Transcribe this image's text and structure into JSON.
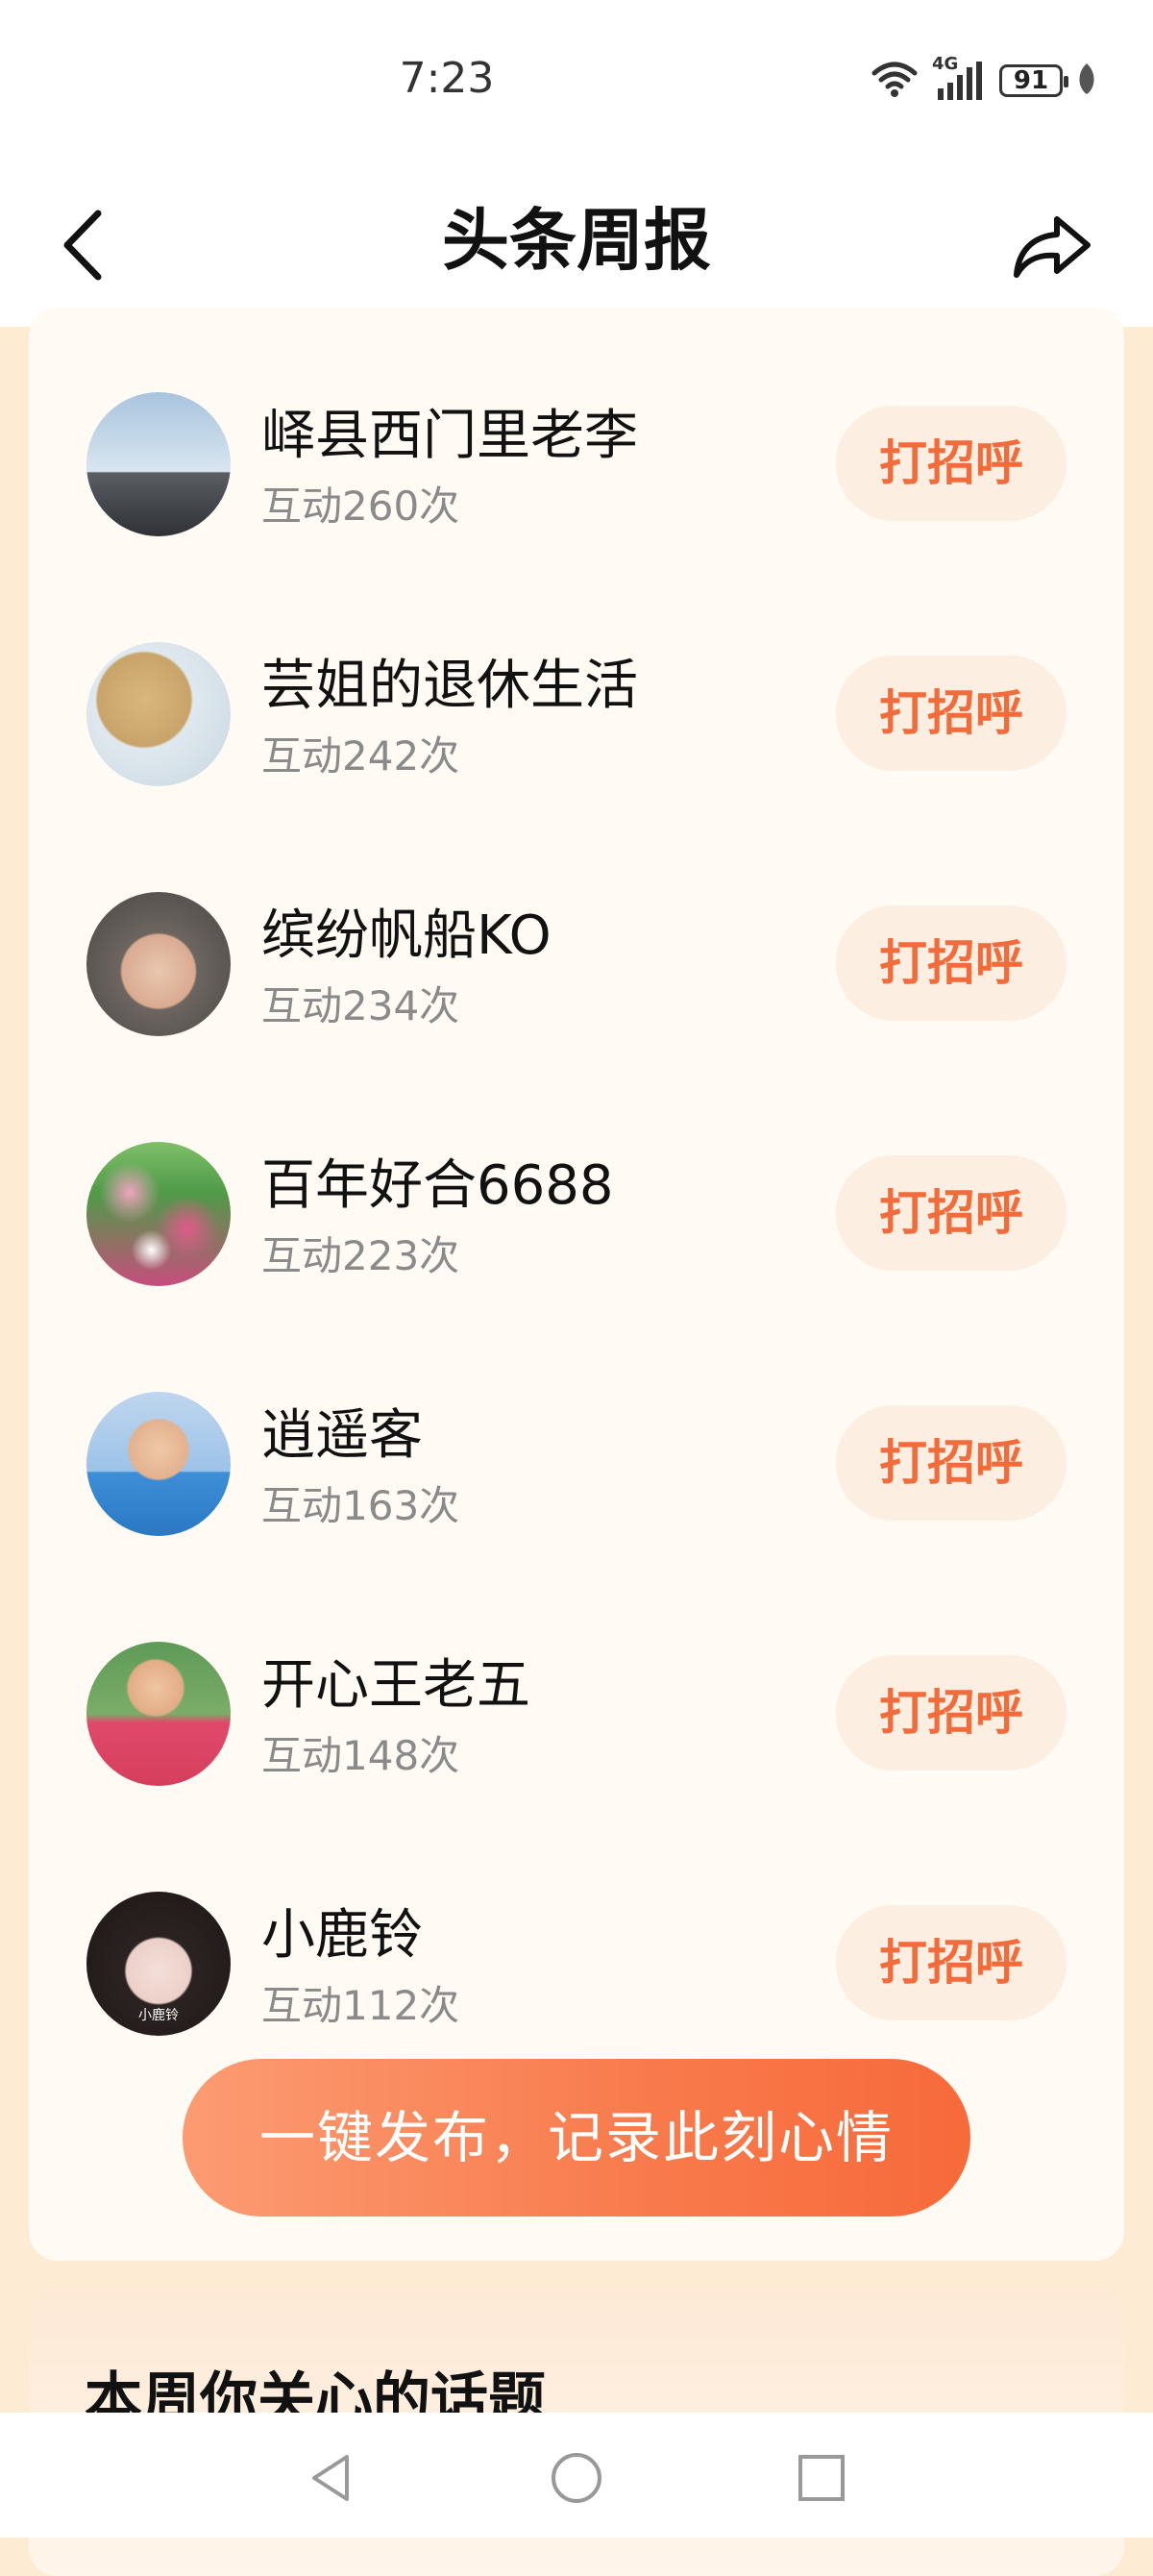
{
  "status_bar": {
    "time": "7:23",
    "network": "4G",
    "battery": "91",
    "icons": [
      "wifi-icon",
      "signal-icon",
      "battery-icon",
      "leaf-icon"
    ]
  },
  "header": {
    "title": "头条周报",
    "back_icon": "chevron-left-icon",
    "share_icon": "share-icon"
  },
  "contacts": [
    {
      "name": "峄县西门里老李",
      "count": "互动260次",
      "button": "打招呼",
      "avatar_color": "#9fb6cc"
    },
    {
      "name": "芸姐的退休生活",
      "count": "互动242次",
      "button": "打招呼",
      "avatar_color": "#d9c6a3"
    },
    {
      "name": "缤纷帆船KO",
      "count": "互动234次",
      "button": "打招呼",
      "avatar_color": "#8d7a6a"
    },
    {
      "name": "百年好合6688",
      "count": "互动223次",
      "button": "打招呼",
      "avatar_color": "#c3557a"
    },
    {
      "name": "逍遥客",
      "count": "互动163次",
      "button": "打招呼",
      "avatar_color": "#3f8ed8"
    },
    {
      "name": "开心王老五",
      "count": "互动148次",
      "button": "打招呼",
      "avatar_color": "#e25268"
    },
    {
      "name": "小鹿铃",
      "count": "互动112次",
      "button": "打招呼",
      "avatar_color": "#e9d9d6",
      "avatar_text": "小鹿铃"
    }
  ],
  "publish_button": "一键发布，记录此刻心情",
  "topics": {
    "title": "本周你关心的话题"
  },
  "nav": {
    "icons": [
      "back-triangle-icon",
      "home-circle-icon",
      "recents-square-icon"
    ]
  },
  "colors": {
    "accent": "#f26b3a",
    "page_background": "#fdebd3",
    "card_background": "#fffaf3",
    "greet_button_bg": "#fdeee2"
  }
}
